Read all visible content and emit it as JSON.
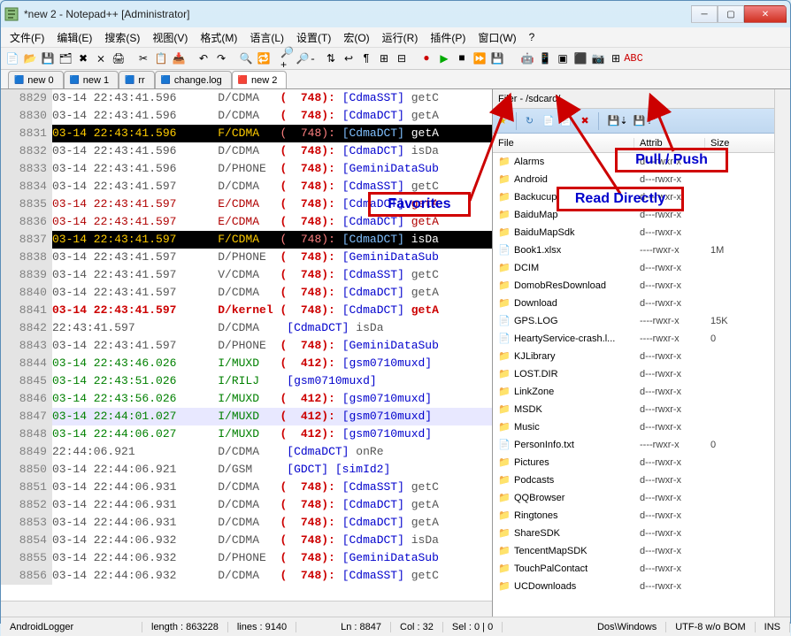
{
  "window": {
    "title": "*new 2 - Notepad++ [Administrator]"
  },
  "menus": [
    "文件(F)",
    "编辑(E)",
    "搜索(S)",
    "视图(V)",
    "格式(M)",
    "语言(L)",
    "设置(T)",
    "宏(O)",
    "运行(R)",
    "插件(P)",
    "窗口(W)",
    "?"
  ],
  "tabs": [
    {
      "label": "new  0",
      "active": false
    },
    {
      "label": "new  1",
      "active": false
    },
    {
      "label": "rr",
      "active": false
    },
    {
      "label": "change.log",
      "active": false
    },
    {
      "label": "new  2",
      "active": true
    }
  ],
  "first_line_no": 8829,
  "lines": [
    {
      "ts": "03-14 22:43:41.596",
      "tag": "D/CDMA",
      "pid": "748",
      "mod": "[CdmaSST]",
      "msg": "getC",
      "cls": "d-gray",
      "hl": false
    },
    {
      "ts": "03-14 22:43:41.596",
      "tag": "D/CDMA",
      "pid": "748",
      "mod": "[CdmaDCT]",
      "msg": "getA",
      "cls": "d-gray",
      "hl": false
    },
    {
      "ts": "03-14 22:43:41.596",
      "tag": "F/CDMA",
      "pid": "748",
      "mod": "[CdmaDCT]",
      "msg": "getA",
      "cls": "",
      "hl": true
    },
    {
      "ts": "03-14 22:43:41.596",
      "tag": "D/CDMA",
      "pid": "748",
      "mod": "[CdmaDCT]",
      "msg": "isDa",
      "cls": "d-gray",
      "hl": false
    },
    {
      "ts": "03-14 22:43:41.596",
      "tag": "D/PHONE",
      "pid": "748",
      "mod": "[GeminiDataSub",
      "msg": "",
      "cls": "d-gray",
      "hl": false
    },
    {
      "ts": "03-14 22:43:41.597",
      "tag": "D/CDMA",
      "pid": "748",
      "mod": "[CdmaSST]",
      "msg": "getC",
      "cls": "d-gray",
      "hl": false
    },
    {
      "ts": "03-14 22:43:41.597",
      "tag": "E/CDMA",
      "pid": "748",
      "mod": "[CdmaDCT]",
      "msg": "getA",
      "cls": "d-red",
      "hl": false
    },
    {
      "ts": "03-14 22:43:41.597",
      "tag": "E/CDMA",
      "pid": "748",
      "mod": "[CdmaDCT]",
      "msg": "getA",
      "cls": "d-red",
      "hl": false
    },
    {
      "ts": "03-14 22:43:41.597",
      "tag": "F/CDMA",
      "pid": "748",
      "mod": "[CdmaDCT]",
      "msg": "isDa",
      "cls": "",
      "hl": true
    },
    {
      "ts": "03-14 22:43:41.597",
      "tag": "D/PHONE",
      "pid": "748",
      "mod": "[GeminiDataSub",
      "msg": "",
      "cls": "d-gray",
      "hl": false
    },
    {
      "ts": "03-14 22:43:41.597",
      "tag": "V/CDMA",
      "pid": "748",
      "mod": "[CdmaSST]",
      "msg": "getC",
      "cls": "d-gray",
      "hl": false
    },
    {
      "ts": "03-14 22:43:41.597",
      "tag": "D/CDMA",
      "pid": "748",
      "mod": "[CdmaDCT]",
      "msg": "getA",
      "cls": "d-gray",
      "hl": false
    },
    {
      "ts": "03-14 22:43:41.597",
      "tag": "D/kernel",
      "pid": "748",
      "mod": "[CdmaDCT]",
      "msg": "getA",
      "cls": "br-red",
      "hl": false
    },
    {
      "ts": "22:43:41.597",
      "tag": "D/CDMA",
      "pid": "",
      "mod": "[CdmaDCT]",
      "msg": "isDa",
      "cls": "d-gray",
      "hl": false
    },
    {
      "ts": "03-14 22:43:41.597",
      "tag": "D/PHONE",
      "pid": "748",
      "mod": "[GeminiDataSub",
      "msg": "",
      "cls": "d-gray",
      "hl": false
    },
    {
      "ts": "03-14 22:43:46.026",
      "tag": "I/MUXD",
      "pid": "412",
      "mod": "[gsm0710muxd]",
      "msg": "",
      "cls": "d-green",
      "hl": false
    },
    {
      "ts": "03-14 22:43:51.026",
      "tag": "I/RILJ",
      "pid": "",
      "mod": "[gsm0710muxd]",
      "msg": "",
      "cls": "d-green",
      "hl": false
    },
    {
      "ts": "03-14 22:43:56.026",
      "tag": "I/MUXD",
      "pid": "412",
      "mod": "[gsm0710muxd]",
      "msg": "",
      "cls": "d-green",
      "hl": false
    },
    {
      "ts": "03-14 22:44:01.027",
      "tag": "I/MUXD",
      "pid": "412",
      "mod": "[gsm0710muxd]",
      "msg": "",
      "cls": "d-green",
      "hl": false,
      "curs": true
    },
    {
      "ts": "03-14 22:44:06.027",
      "tag": "I/MUXD",
      "pid": "412",
      "mod": "[gsm0710muxd]",
      "msg": "",
      "cls": "d-green",
      "hl": false
    },
    {
      "ts": "22:44:06.921",
      "tag": "D/CDMA",
      "pid": "",
      "mod": "[CdmaDCT]",
      "msg": "onRe",
      "cls": "d-gray",
      "hl": false
    },
    {
      "ts": "03-14 22:44:06.921",
      "tag": "D/GSM",
      "pid": "",
      "mod": "[GDCT] [simId2]",
      "msg": "",
      "cls": "d-gray",
      "hl": false
    },
    {
      "ts": "03-14 22:44:06.931",
      "tag": "D/CDMA",
      "pid": "748",
      "mod": "[CdmaSST]",
      "msg": "getC",
      "cls": "d-gray",
      "hl": false
    },
    {
      "ts": "03-14 22:44:06.931",
      "tag": "D/CDMA",
      "pid": "748",
      "mod": "[CdmaDCT]",
      "msg": "getA",
      "cls": "d-gray",
      "hl": false
    },
    {
      "ts": "03-14 22:44:06.931",
      "tag": "D/CDMA",
      "pid": "748",
      "mod": "[CdmaDCT]",
      "msg": "getA",
      "cls": "d-gray",
      "hl": false
    },
    {
      "ts": "03-14 22:44:06.932",
      "tag": "D/CDMA",
      "pid": "748",
      "mod": "[CdmaDCT]",
      "msg": "isDa",
      "cls": "d-gray",
      "hl": false
    },
    {
      "ts": "03-14 22:44:06.932",
      "tag": "D/PHONE",
      "pid": "748",
      "mod": "[GeminiDataSub",
      "msg": "",
      "cls": "d-gray",
      "hl": false
    },
    {
      "ts": "03-14 22:44:06.932",
      "tag": "D/CDMA",
      "pid": "748",
      "mod": "[CdmaSST]",
      "msg": "getC",
      "cls": "d-gray",
      "hl": false
    }
  ],
  "filer": {
    "title": "Filer - /sdcard/",
    "columns": {
      "file": "File",
      "attr": "Attrib",
      "size": "Size"
    },
    "rows": [
      {
        "name": "Alarms",
        "type": "folder",
        "attr": "d---rwxr-x",
        "size": ""
      },
      {
        "name": "Android",
        "type": "folder",
        "attr": "d---rwxr-x",
        "size": ""
      },
      {
        "name": "Backucup",
        "type": "folder",
        "attr": "d---rwxr-x",
        "size": ""
      },
      {
        "name": "BaiduMap",
        "type": "folder",
        "attr": "d---rwxr-x",
        "size": ""
      },
      {
        "name": "BaiduMapSdk",
        "type": "folder",
        "attr": "d---rwxr-x",
        "size": ""
      },
      {
        "name": "Book1.xlsx",
        "type": "file",
        "attr": "----rwxr-x",
        "size": "1M"
      },
      {
        "name": "DCIM",
        "type": "folder",
        "attr": "d---rwxr-x",
        "size": ""
      },
      {
        "name": "DomobResDownload",
        "type": "folder",
        "attr": "d---rwxr-x",
        "size": ""
      },
      {
        "name": "Download",
        "type": "folder",
        "attr": "d---rwxr-x",
        "size": ""
      },
      {
        "name": "GPS.LOG",
        "type": "file",
        "attr": "----rwxr-x",
        "size": "15K"
      },
      {
        "name": "HeartyService-crash.l...",
        "type": "file",
        "attr": "----rwxr-x",
        "size": "0"
      },
      {
        "name": "KJLibrary",
        "type": "folder",
        "attr": "d---rwxr-x",
        "size": ""
      },
      {
        "name": "LOST.DIR",
        "type": "folder",
        "attr": "d---rwxr-x",
        "size": ""
      },
      {
        "name": "LinkZone",
        "type": "folder",
        "attr": "d---rwxr-x",
        "size": ""
      },
      {
        "name": "MSDK",
        "type": "folder",
        "attr": "d---rwxr-x",
        "size": ""
      },
      {
        "name": "Music",
        "type": "folder",
        "attr": "d---rwxr-x",
        "size": ""
      },
      {
        "name": "PersonInfo.txt",
        "type": "file",
        "attr": "----rwxr-x",
        "size": "0"
      },
      {
        "name": "Pictures",
        "type": "folder",
        "attr": "d---rwxr-x",
        "size": ""
      },
      {
        "name": "Podcasts",
        "type": "folder",
        "attr": "d---rwxr-x",
        "size": ""
      },
      {
        "name": "QQBrowser",
        "type": "folder",
        "attr": "d---rwxr-x",
        "size": ""
      },
      {
        "name": "Ringtones",
        "type": "folder",
        "attr": "d---rwxr-x",
        "size": ""
      },
      {
        "name": "ShareSDK",
        "type": "folder",
        "attr": "d---rwxr-x",
        "size": ""
      },
      {
        "name": "TencentMapSDK",
        "type": "folder",
        "attr": "d---rwxr-x",
        "size": ""
      },
      {
        "name": "TouchPalContact",
        "type": "folder",
        "attr": "d---rwxr-x",
        "size": ""
      },
      {
        "name": "UCDownloads",
        "type": "folder",
        "attr": "d---rwxr-x",
        "size": ""
      }
    ]
  },
  "status": {
    "lang": "AndroidLogger",
    "length": "length : 863228",
    "lines": "lines : 9140",
    "ln": "Ln : 8847",
    "col": "Col : 32",
    "sel": "Sel : 0 | 0",
    "eol": "Dos\\Windows",
    "enc": "UTF-8 w/o BOM",
    "ins": "INS"
  },
  "annot": {
    "fav": "Favorites",
    "pull": "Pull / Push",
    "read": "Read Directly"
  }
}
